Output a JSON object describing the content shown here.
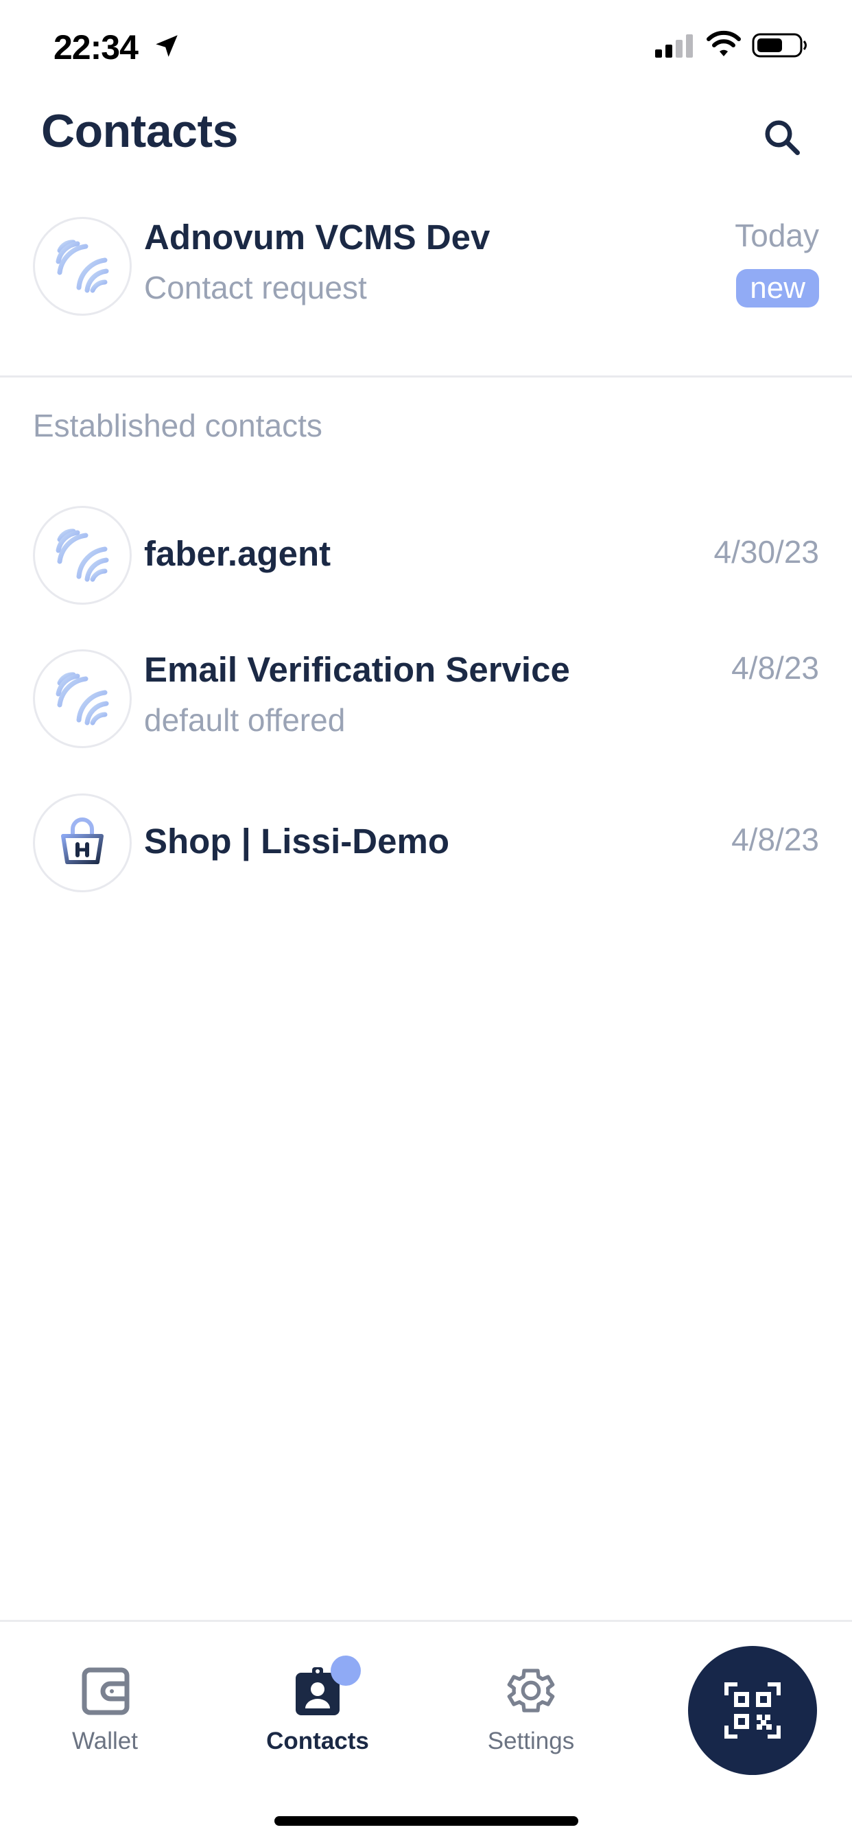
{
  "status_bar": {
    "time": "22:34"
  },
  "header": {
    "title": "Contacts"
  },
  "pending": [
    {
      "name": "Adnovum VCMS Dev",
      "subtitle": "Contact request",
      "date": "Today",
      "badge": "new",
      "avatar": "signal-logo-icon"
    }
  ],
  "established": {
    "label": "Established contacts",
    "contacts": [
      {
        "name": "faber.agent",
        "subtitle": "",
        "date": "4/30/23",
        "avatar": "signal-logo-icon"
      },
      {
        "name": "Email Verification Service",
        "subtitle": "default offered",
        "date": "4/8/23",
        "avatar": "signal-logo-icon"
      },
      {
        "name": "Shop | Lissi-Demo",
        "subtitle": "",
        "date": "4/8/23",
        "avatar": "shopping-basket-icon"
      }
    ]
  },
  "tabbar": {
    "tabs": [
      {
        "label": "Wallet",
        "icon": "wallet-icon",
        "active": false
      },
      {
        "label": "Contacts",
        "icon": "contact-badge-icon",
        "active": true
      },
      {
        "label": "Settings",
        "icon": "gear-icon",
        "active": false
      }
    ],
    "scan_icon": "qr-code-icon"
  },
  "colors": {
    "primary": "#1b2945",
    "accent": "#91abf5",
    "muted": "#9aa3b5"
  }
}
